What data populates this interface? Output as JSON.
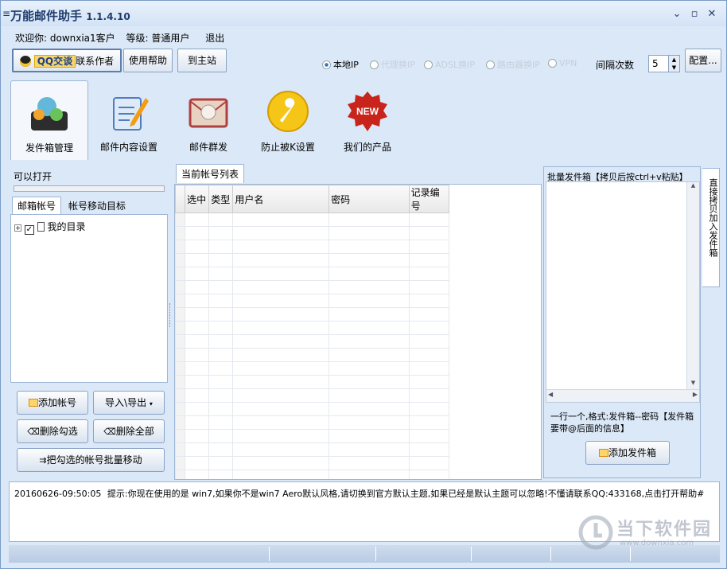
{
  "window": {
    "title": "万能邮件助手",
    "version": "1.1.4.10",
    "menu_icon": "≡",
    "min": "⌄",
    "max": "▫",
    "close": "✕"
  },
  "welcome": {
    "greeting": "欢迎你: downxia1客户",
    "level": "等级: 普通用户",
    "logout": "退出"
  },
  "toolbar": {
    "qq_label": "QQ交谈",
    "contact_label": "联系作者",
    "help_label": "使用帮助",
    "site_label": "到主站",
    "ip_options": [
      {
        "label": "本地IP",
        "selected": true
      },
      {
        "label": "代理换IP",
        "selected": false
      },
      {
        "label": "ADSL换IP",
        "selected": false
      },
      {
        "label": "路由器换IP",
        "selected": false
      },
      {
        "label": "VPN",
        "selected": false
      }
    ],
    "interval_label": "间隔次数",
    "interval_value": "5",
    "config_label": "配置..."
  },
  "nav": [
    {
      "label": "发件箱管理",
      "icon": "outbox-manage-icon"
    },
    {
      "label": "邮件内容设置",
      "icon": "edit-document-icon"
    },
    {
      "label": "邮件群发",
      "icon": "envelope-icon"
    },
    {
      "label": "防止被K设置",
      "icon": "wrench-icon"
    },
    {
      "label": "我们的产品",
      "icon": "new-badge-icon"
    }
  ],
  "left": {
    "status": "可以打开",
    "tabs": [
      "邮箱帐号",
      "帐号移动目标"
    ],
    "tree_root": "我的目录",
    "buttons": {
      "add": "添加帐号",
      "import": "导入\\导出",
      "del_checked": "删除勾选",
      "del_all": "删除全部",
      "batch_move": "把勾选的帐号批量移动"
    }
  },
  "center": {
    "tab": "当前帐号列表",
    "columns": [
      "选中",
      "类型",
      "用户名",
      "密码",
      "记录编号"
    ]
  },
  "right": {
    "title": "批量发件箱【拷贝后按ctrl+v粘贴】",
    "hint": "一行一个,格式:发件箱--密码【发件箱要带@后面的信息】",
    "add_button": "添加发件箱",
    "side_tab": "直接拷贝加入发件箱"
  },
  "log": {
    "timestamp": "20160626-09:50:05",
    "message": "提示:你现在使用的是 win7,如果你不是win7 Aero默认风格,请切换到官方默认主题,如果已经是默认主题可以忽略!不懂请联系QQ:433168,点击打开帮助#"
  },
  "watermark": {
    "text": "当下软件园",
    "url": "www.downxia.com"
  }
}
